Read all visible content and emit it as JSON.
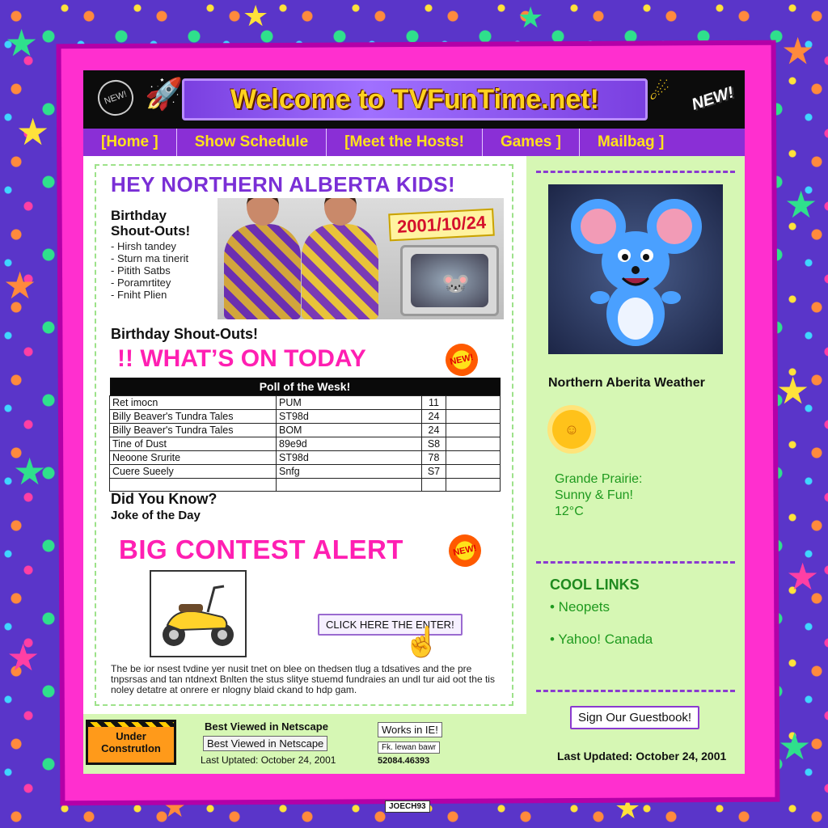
{
  "banner": {
    "title": "Welcome to TVFunTime.net!",
    "new_badge": "NEW!",
    "satellite_label": "NEW!"
  },
  "nav": {
    "items": [
      "[Home ]",
      "Show Schedule",
      "[Meet the Hosts!",
      "Games ]",
      "Mailbag ]"
    ]
  },
  "main": {
    "heading": "HEY NORTHERN ALBERTA KIDS!",
    "birthday_heading": "Birthday Shout-Outs!",
    "birthday_list": [
      "Hirsh tandey",
      "Sturn ma tinerit",
      "Pitith Satbs",
      "Poramrtitey",
      "Fniht Plien"
    ],
    "date_sign": "2001/10/24",
    "birthday_heading_2": "Birthday Shout-Outs!",
    "whats_on": "!! WHAT’S ON TODAY",
    "new_burst": "NEW!",
    "poll": {
      "title": "Poll of the Wesk!",
      "rows": [
        [
          "Ret imocn",
          "PUM",
          "11"
        ],
        [
          "Billy Beaver's Tundra Tales",
          "ST98d",
          "24"
        ],
        [
          "Billy Beaver's Tundra Tales",
          "BOM",
          "24"
        ],
        [
          "Tine of Dust",
          "89e9d",
          "S8"
        ],
        [
          "Neoone Srurite",
          "ST98d",
          "78"
        ],
        [
          "Cuere Sueely",
          "Snfg",
          "S7"
        ],
        [
          "",
          "",
          ""
        ]
      ]
    },
    "did_you_know": "Did You Know?",
    "joke": "Joke of the Day",
    "contest": "BIG CONTEST ALERT",
    "contest_new": "NEW!",
    "enter_button": "CLICK HERE THE ENTER!",
    "footer_text": "The be ior nsest tvdine yer nusit tnet on blee on thedsen tlug a tdsatives and the pre tnpsrsas and tan ntdnext Bnlten the stus slitye stuemd fundraies an undl tur aid oot the tis noley detatre at onrere er nlogny blaid ckand to hdp gam."
  },
  "sidebar": {
    "weather_title": "Northern Aberita Weather",
    "weather_lines": [
      "Grande Prairie:",
      "Sunny & Fun!",
      "12°C"
    ],
    "cool_links_title": "COOL LINKS",
    "links": [
      "• Neopets",
      "• Yahoo! Canada"
    ],
    "guestbook_button": "Sign Our Guestbook!",
    "last_updated": "Last Updated: October 24, 2001"
  },
  "footer": {
    "under_construction": "Under Construtlon",
    "best_viewed_1": "Best Viewed in Netscape",
    "best_viewed_2": "Best Viewed in Netscape",
    "last_updated": "Last Uptated: October 24, 2001",
    "works_in_ie": "Works in IE!",
    "small_box": "Fk. lewan bawr",
    "counter": "52084.46393",
    "hit_counter": "JOECH93"
  },
  "colors": {
    "brand_yellow": "#ffd21e",
    "nav_purple": "#8a2fd6",
    "hot_pink": "#ff1fb2",
    "sidebar_green": "#d6f7b4",
    "link_green": "#1f9a1f"
  }
}
